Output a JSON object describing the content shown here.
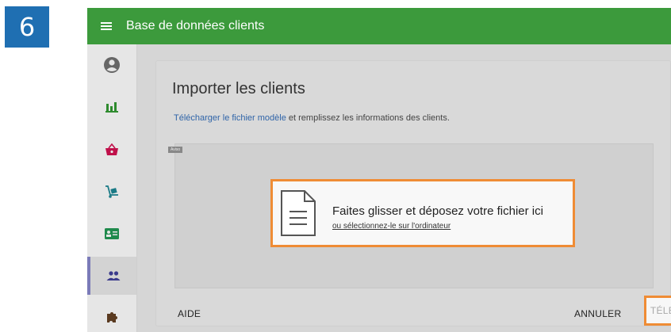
{
  "step": {
    "number": "6",
    "color": "#1f6fb2"
  },
  "app": {
    "title": "Base de données clients",
    "header_color": "#3c9a3c"
  },
  "sidebar": {
    "items": [
      {
        "name": "account",
        "icon": "account-circle-icon"
      },
      {
        "name": "statistics",
        "icon": "bar-chart-icon"
      },
      {
        "name": "shop",
        "icon": "basket-icon"
      },
      {
        "name": "delivery",
        "icon": "hand-truck-icon"
      },
      {
        "name": "id-card",
        "icon": "id-card-icon"
      },
      {
        "name": "clients",
        "icon": "people-icon",
        "active": true
      },
      {
        "name": "extensions",
        "icon": "puzzle-icon"
      }
    ]
  },
  "import_card": {
    "title": "Importer les clients",
    "template_link": "Télécharger le fichier modèle",
    "instruction": " et remplissez les informations des clients.",
    "dropzone_tag": "Aviso",
    "drop_main": "Faites glisser et déposez votre fichier ici",
    "drop_alt": "ou sélectionnez-le sur l'ordinateur",
    "buttons": {
      "help": "AIDE",
      "cancel": "ANNULER",
      "upload": "TÉLÉCHARGER"
    },
    "highlight_color": "#ef8c35"
  }
}
